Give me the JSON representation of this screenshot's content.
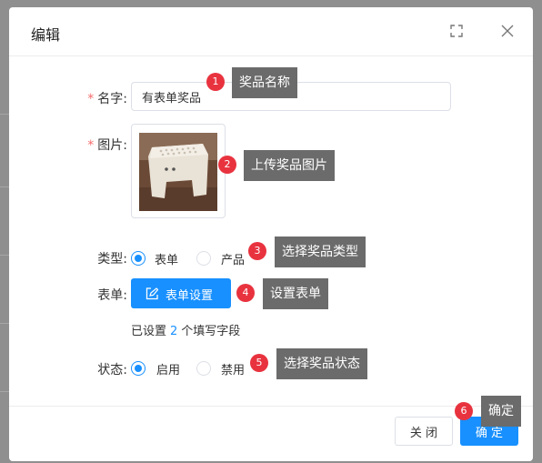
{
  "dialog": {
    "title": "编辑",
    "maximize_icon": "expand-icon",
    "close_icon": "close-icon"
  },
  "form": {
    "name_label": "名字:",
    "name_value": "有表单奖品",
    "image_label": "图片:",
    "image_icon": "photo-stool-thumbnail",
    "type_label": "类型:",
    "type_options": [
      "表单",
      "产品"
    ],
    "type_selected": "表单",
    "form_label": "表单:",
    "form_button_label": "表单设置",
    "form_button_icon": "edit-icon",
    "fields_prefix": "已设置",
    "fields_count": "2",
    "fields_suffix": "个填写字段",
    "status_label": "状态:",
    "status_options": [
      "启用",
      "禁用"
    ],
    "status_selected": "启用"
  },
  "footer": {
    "close_label": "关 闭",
    "confirm_label": "确 定"
  },
  "annotations": [
    {
      "num": "1",
      "text": "奖品名称"
    },
    {
      "num": "2",
      "text": "上传奖品图片"
    },
    {
      "num": "3",
      "text": "选择奖品类型"
    },
    {
      "num": "4",
      "text": "设置表单"
    },
    {
      "num": "5",
      "text": "选择奖品状态"
    },
    {
      "num": "6",
      "text": "确定"
    }
  ],
  "colors": {
    "primary": "#1890ff",
    "required": "#f56c6c",
    "badge": "#e8333f",
    "tooltip": "#6b6b6b"
  }
}
